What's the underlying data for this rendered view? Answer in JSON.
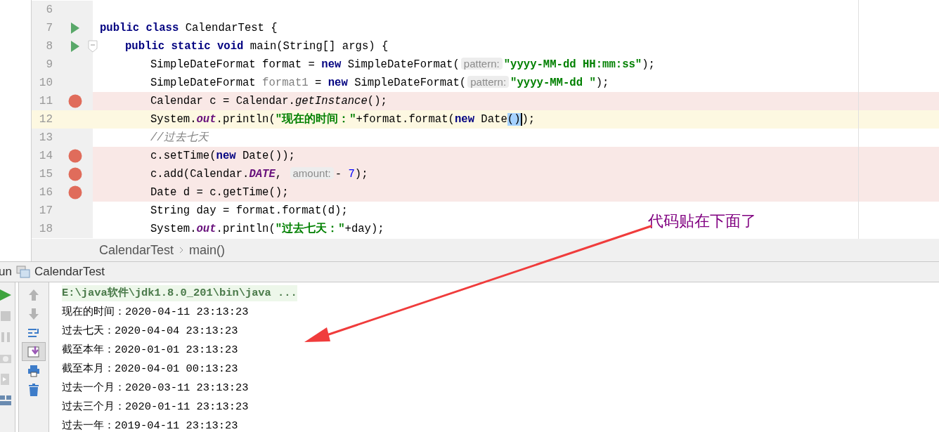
{
  "editor": {
    "lines": [
      {
        "number": "6",
        "run": false,
        "fold": false,
        "breakpoint": false,
        "current": false
      },
      {
        "number": "7",
        "run": true,
        "fold": false,
        "breakpoint": false,
        "current": false,
        "tokens": [
          {
            "t": "public class ",
            "kind": "keyword"
          },
          {
            "t": "CalendarTest {",
            "kind": "plain"
          }
        ],
        "children": [
          {
            "number": "8",
            "run": true,
            "fold": true,
            "breakpoint": false,
            "current": false,
            "tokens": [
              {
                "t": "public static void ",
                "kind": "keyword"
              },
              {
                "t": "main(String[] args) {",
                "kind": "plain"
              }
            ],
            "children": [
              {
                "number": "9",
                "run": false,
                "fold": false,
                "breakpoint": false,
                "current": false,
                "tokens": [
                  {
                    "t": "SimpleDateFormat format = ",
                    "kind": "plain"
                  },
                  {
                    "t": "new ",
                    "kind": "keyword"
                  },
                  {
                    "t": "SimpleDateFormat(",
                    "kind": "plain"
                  },
                  {
                    "t": "pattern:",
                    "kind": "hint"
                  },
                  {
                    "t": "\"yyyy-MM-dd HH:mm:ss\"",
                    "kind": "string"
                  },
                  {
                    "t": ");",
                    "kind": "plain"
                  }
                ]
              },
              {
                "number": "10",
                "run": false,
                "fold": false,
                "breakpoint": false,
                "current": false,
                "tokens": [
                  {
                    "t": "SimpleDateFormat ",
                    "kind": "plain"
                  },
                  {
                    "t": "format1",
                    "kind": "unused"
                  },
                  {
                    "t": " = ",
                    "kind": "plain"
                  },
                  {
                    "t": "new ",
                    "kind": "keyword"
                  },
                  {
                    "t": "SimpleDateFormat(",
                    "kind": "plain"
                  },
                  {
                    "t": "pattern:",
                    "kind": "hint"
                  },
                  {
                    "t": "\"yyyy-MM-dd \"",
                    "kind": "string"
                  },
                  {
                    "t": ");",
                    "kind": "plain"
                  }
                ]
              },
              {
                "number": "11",
                "run": false,
                "fold": false,
                "breakpoint": true,
                "current": false,
                "tokens": [
                  {
                    "t": "Calendar c = Calendar.",
                    "kind": "plain"
                  },
                  {
                    "t": "getInstance",
                    "kind": "static"
                  },
                  {
                    "t": "();",
                    "kind": "plain"
                  }
                ]
              },
              {
                "number": "12",
                "run": false,
                "fold": false,
                "breakpoint": false,
                "current": true,
                "tokens": [
                  {
                    "t": "System.",
                    "kind": "plain"
                  },
                  {
                    "t": "out",
                    "kind": "field"
                  },
                  {
                    "t": ".println(",
                    "kind": "plain"
                  },
                  {
                    "t": "\"现在的时间：\"",
                    "kind": "string"
                  },
                  {
                    "t": "+format.format(",
                    "kind": "plain"
                  },
                  {
                    "t": "new ",
                    "kind": "keyword"
                  },
                  {
                    "t": "Date",
                    "kind": "plain"
                  },
                  {
                    "t": "()",
                    "kind": "selection"
                  },
                  {
                    "t": ");",
                    "kind": "plain"
                  }
                ]
              },
              {
                "number": "13",
                "run": false,
                "fold": false,
                "breakpoint": false,
                "current": false,
                "tokens": [
                  {
                    "t": "//过去七天",
                    "kind": "comment"
                  }
                ]
              },
              {
                "number": "14",
                "run": false,
                "fold": false,
                "breakpoint": true,
                "current": false,
                "tokens": [
                  {
                    "t": "c.setTime(",
                    "kind": "plain"
                  },
                  {
                    "t": "new ",
                    "kind": "keyword"
                  },
                  {
                    "t": "Date());",
                    "kind": "plain"
                  }
                ]
              },
              {
                "number": "15",
                "run": false,
                "fold": false,
                "breakpoint": true,
                "current": false,
                "tokens": [
                  {
                    "t": "c.add(Calendar.",
                    "kind": "plain"
                  },
                  {
                    "t": "DATE",
                    "kind": "field"
                  },
                  {
                    "t": ", ",
                    "kind": "plain"
                  },
                  {
                    "t": "amount:",
                    "kind": "hint"
                  },
                  {
                    "t": "- ",
                    "kind": "plain"
                  },
                  {
                    "t": "7",
                    "kind": "number"
                  },
                  {
                    "t": ");",
                    "kind": "plain"
                  }
                ]
              },
              {
                "number": "16",
                "run": false,
                "fold": false,
                "breakpoint": true,
                "current": false,
                "tokens": [
                  {
                    "t": "Date d = c.getTime();",
                    "kind": "plain"
                  }
                ]
              },
              {
                "number": "17",
                "run": false,
                "fold": false,
                "breakpoint": false,
                "current": false,
                "tokens": [
                  {
                    "t": "String day = format.format(d);",
                    "kind": "plain"
                  }
                ]
              },
              {
                "number": "18",
                "run": false,
                "fold": false,
                "breakpoint": false,
                "current": false,
                "tokens": [
                  {
                    "t": "System.",
                    "kind": "plain"
                  },
                  {
                    "t": "out",
                    "kind": "field"
                  },
                  {
                    "t": ".println(",
                    "kind": "plain"
                  },
                  {
                    "t": "\"过去七天：\"",
                    "kind": "string"
                  },
                  {
                    "t": "+day);",
                    "kind": "plain"
                  }
                ]
              }
            ]
          }
        ]
      }
    ]
  },
  "breadcrumb": [
    "CalendarTest",
    "main()"
  ],
  "run_panel": {
    "tab_label": "un",
    "config": "CalendarTest",
    "side_tools": [
      {
        "kind": "run",
        "disabled": false
      },
      {
        "kind": "stop",
        "disabled": true
      },
      {
        "kind": "pause",
        "disabled": true
      },
      {
        "kind": "camera",
        "disabled": true
      },
      {
        "kind": "exit",
        "disabled": true
      },
      {
        "kind": "layout",
        "disabled": false
      }
    ],
    "tools": [
      {
        "kind": "up",
        "selected": false
      },
      {
        "kind": "down",
        "selected": false
      },
      {
        "kind": "wrap",
        "selected": false
      },
      {
        "kind": "scroll",
        "selected": true
      },
      {
        "kind": "print",
        "selected": false
      },
      {
        "kind": "trash",
        "selected": false
      }
    ],
    "command": "E:\\java软件\\jdk1.8.0_201\\bin\\java ...",
    "output": [
      "现在的时间：2020-04-11 23:13:23",
      "过去七天：2020-04-04 23:13:23",
      "截至本年：2020-01-01 23:13:23",
      "截至本月：2020-04-01 00:13:23",
      "过去一个月：2020-03-11 23:13:23",
      "过去三个月：2020-01-11 23:13:23",
      "过去一年：2019-04-11 23:13:23"
    ]
  },
  "annotation": {
    "text": "代码贴在下面了"
  }
}
